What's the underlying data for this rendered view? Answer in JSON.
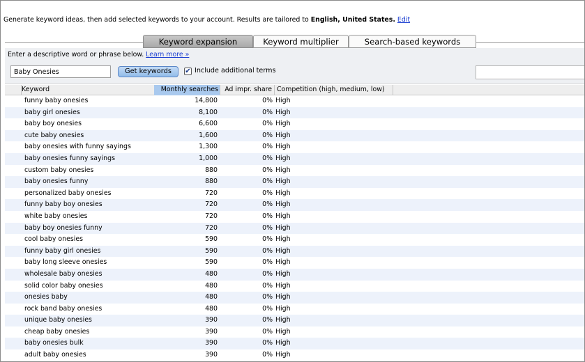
{
  "intro": {
    "text_before": "Generate keyword ideas, then add selected keywords to your account. Results are tailored to ",
    "language": "English",
    "comma": ", ",
    "country": "United States.",
    "edit_link": "Edit"
  },
  "tabs": [
    {
      "label": "Keyword expansion",
      "active": true
    },
    {
      "label": "Keyword multiplier",
      "active": false
    },
    {
      "label": "Search-based keywords",
      "active": false
    }
  ],
  "form": {
    "hint_text": "Enter a descriptive word or phrase below.",
    "learn_more": "Learn more »",
    "keyword_value": "Baby Onesies",
    "get_button": "Get keywords",
    "include_checked": true,
    "include_label": "Include additional terms",
    "filter_value": ""
  },
  "table": {
    "headers": {
      "keyword": "Keyword",
      "monthly": "Monthly searches",
      "impr": "Ad impr. share",
      "competition": "Competition (high, medium, low)"
    },
    "rows": [
      {
        "keyword": "funny baby onesies",
        "monthly": "14,800",
        "impr": "0%",
        "competition": "High"
      },
      {
        "keyword": "baby girl onesies",
        "monthly": "8,100",
        "impr": "0%",
        "competition": "High"
      },
      {
        "keyword": "baby boy onesies",
        "monthly": "6,600",
        "impr": "0%",
        "competition": "High"
      },
      {
        "keyword": "cute baby onesies",
        "monthly": "1,600",
        "impr": "0%",
        "competition": "High"
      },
      {
        "keyword": "baby onesies with funny sayings",
        "monthly": "1,300",
        "impr": "0%",
        "competition": "High"
      },
      {
        "keyword": "baby onesies funny sayings",
        "monthly": "1,000",
        "impr": "0%",
        "competition": "High"
      },
      {
        "keyword": "custom baby onesies",
        "monthly": "880",
        "impr": "0%",
        "competition": "High"
      },
      {
        "keyword": "baby onesies funny",
        "monthly": "880",
        "impr": "0%",
        "competition": "High"
      },
      {
        "keyword": "personalized baby onesies",
        "monthly": "720",
        "impr": "0%",
        "competition": "High"
      },
      {
        "keyword": "funny baby boy onesies",
        "monthly": "720",
        "impr": "0%",
        "competition": "High"
      },
      {
        "keyword": "white baby onesies",
        "monthly": "720",
        "impr": "0%",
        "competition": "High"
      },
      {
        "keyword": "baby boy onesies funny",
        "monthly": "720",
        "impr": "0%",
        "competition": "High"
      },
      {
        "keyword": "cool baby onesies",
        "monthly": "590",
        "impr": "0%",
        "competition": "High"
      },
      {
        "keyword": "funny baby girl onesies",
        "monthly": "590",
        "impr": "0%",
        "competition": "High"
      },
      {
        "keyword": "baby long sleeve onesies",
        "monthly": "590",
        "impr": "0%",
        "competition": "High"
      },
      {
        "keyword": "wholesale baby onesies",
        "monthly": "480",
        "impr": "0%",
        "competition": "High"
      },
      {
        "keyword": "solid color baby onesies",
        "monthly": "480",
        "impr": "0%",
        "competition": "High"
      },
      {
        "keyword": "onesies baby",
        "monthly": "480",
        "impr": "0%",
        "competition": "High"
      },
      {
        "keyword": "rock band baby onesies",
        "monthly": "480",
        "impr": "0%",
        "competition": "High"
      },
      {
        "keyword": "unique baby onesies",
        "monthly": "390",
        "impr": "0%",
        "competition": "High"
      },
      {
        "keyword": "cheap baby onesies",
        "monthly": "390",
        "impr": "0%",
        "competition": "High"
      },
      {
        "keyword": "baby onesies bulk",
        "monthly": "390",
        "impr": "0%",
        "competition": "High"
      },
      {
        "keyword": "adult baby onesies",
        "monthly": "390",
        "impr": "0%",
        "competition": "High"
      }
    ]
  },
  "colors": {
    "link": "#1c3fd1",
    "active_tab": "#a9a9a9",
    "sorted_header": "#a9c9ee",
    "alt_row": "#edf2fb",
    "button": "#92bce9"
  }
}
